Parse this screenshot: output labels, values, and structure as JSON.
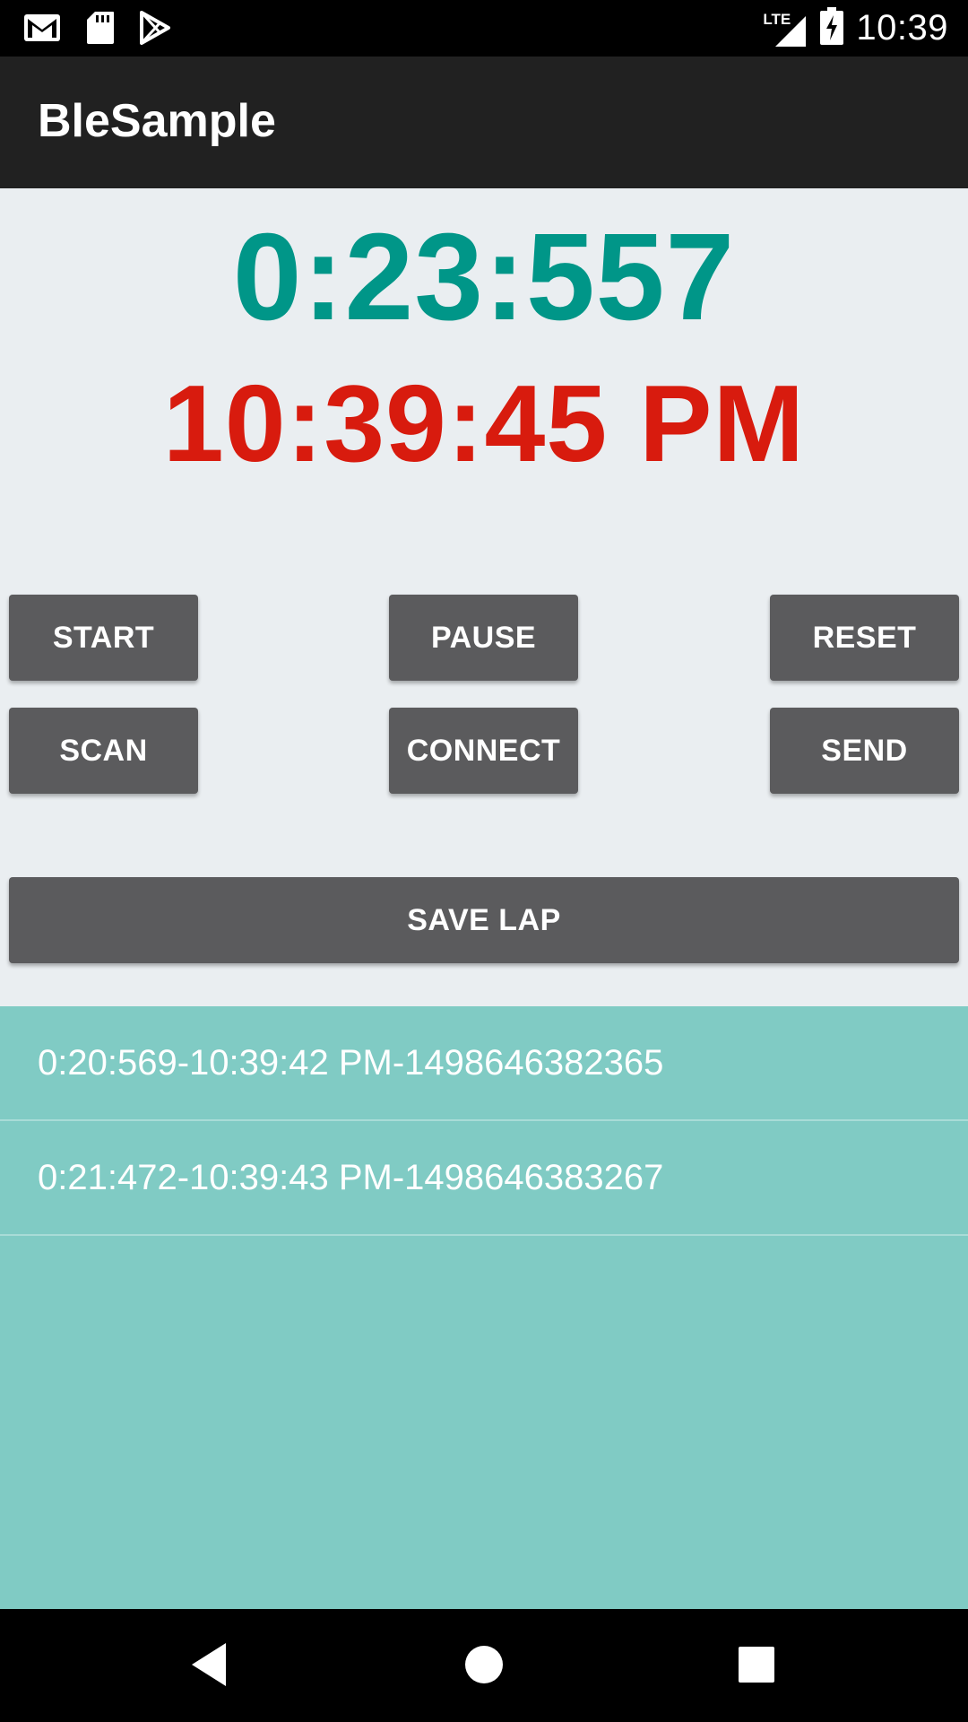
{
  "status_bar": {
    "time": "10:39",
    "network_label": "LTE",
    "icons": [
      "gmail-icon",
      "sd-card-icon",
      "play-store-icon",
      "lte-signal-icon",
      "battery-charging-icon"
    ]
  },
  "app_bar": {
    "title": "BleSample"
  },
  "display": {
    "stopwatch": "0:23:557",
    "clock": "10:39:45 PM"
  },
  "buttons": {
    "start": "START",
    "pause": "PAUSE",
    "reset": "RESET",
    "scan": "SCAN",
    "connect": "CONNECT",
    "send": "SEND",
    "save_lap": "SAVE LAP"
  },
  "laps": [
    "0:20:569-10:39:42 PM-1498646382365",
    "0:21:472-10:39:43 PM-1498646383267"
  ],
  "nav_bar": {
    "icons": [
      "back-icon",
      "home-icon",
      "recents-icon"
    ]
  },
  "colors": {
    "stopwatch": "#009688",
    "clock": "#d81b0e",
    "button": "#5b5b5d",
    "lap_list": "#80cbc4",
    "app_bar": "#212121"
  }
}
